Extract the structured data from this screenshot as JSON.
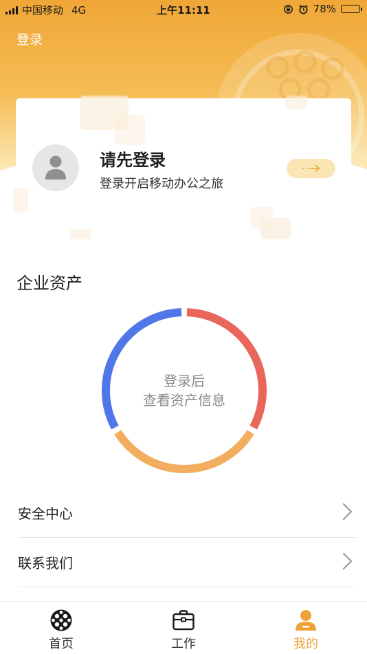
{
  "status_bar": {
    "carrier": "中国移动",
    "network": "4G",
    "time": "上午11:11",
    "battery": "78%",
    "battery_level": 0.78
  },
  "header": {
    "login_link": "登录"
  },
  "login_card": {
    "title": "请先登录",
    "subtitle": "登录开启移动办公之旅"
  },
  "assets": {
    "title": "企业资产",
    "placeholder_line1": "登录后",
    "placeholder_line2": "查看资产信息",
    "ring_colors": [
      "#e8665a",
      "#f2ae5e",
      "#4f77e8"
    ]
  },
  "menu": [
    {
      "label": "安全中心"
    },
    {
      "label": "联系我们"
    }
  ],
  "tabbar": {
    "items": [
      {
        "label": "首页",
        "icon": "home-globe-icon"
      },
      {
        "label": "工作",
        "icon": "briefcase-icon"
      },
      {
        "label": "我的",
        "icon": "user-icon"
      }
    ],
    "active_color": "#f0a23a"
  },
  "colors": {
    "brand": "#f0a637",
    "accent_soft": "#fbe5b5"
  }
}
